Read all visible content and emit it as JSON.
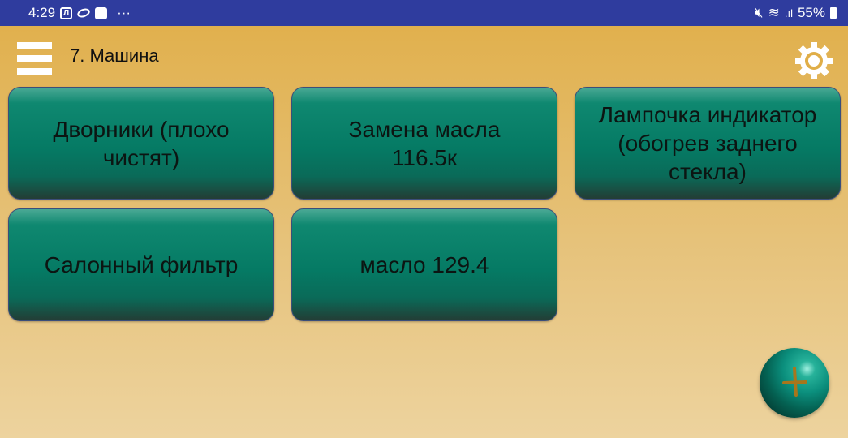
{
  "status_bar": {
    "time": "4:29",
    "notification_icons": [
      "app-icon-l",
      "oval-icon",
      "mail-icon"
    ],
    "more": "···",
    "battery": "55%"
  },
  "toolbar": {
    "title": "7. Машина"
  },
  "tiles": [
    {
      "label": "Дворники (плохо чистят)"
    },
    {
      "label": "Замена масла 116.5к"
    },
    {
      "label": "Лампочка индикатор (обогрев заднего стекла)"
    },
    {
      "label": "Салонный фильтр"
    },
    {
      "label": "масло 129.4"
    }
  ],
  "colors": {
    "status_bar": "#2f3c9e",
    "tile": "#057a64",
    "background": "#e0ae48"
  }
}
